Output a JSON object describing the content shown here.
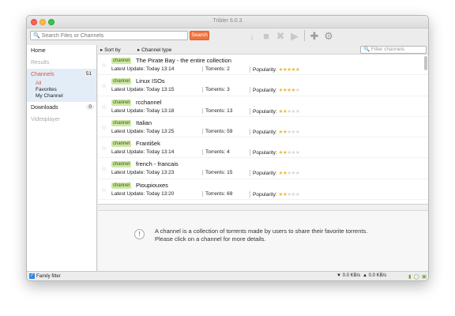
{
  "window": {
    "title": "Tribler 6.0.3"
  },
  "toolbar": {
    "search_placeholder": "Search Files or Channels",
    "search_button": "Search",
    "icons": [
      "download-icon",
      "stop-icon",
      "close-icon",
      "play-icon",
      "add-icon",
      "settings-icon"
    ]
  },
  "sidebar": {
    "home": "Home",
    "results": "Results",
    "channels": "Channels",
    "channels_count": "51",
    "sub_all": "All",
    "sub_favorites": "Favorites",
    "sub_my_channel": "My Channel",
    "downloads": "Downloads",
    "downloads_count": "0",
    "videoplayer": "Videoplayer"
  },
  "list_header": {
    "sort_by": "Sort by",
    "channel_type": "Channel type",
    "filter_placeholder": "Filter channels"
  },
  "channel_badge": "channel",
  "channels": [
    {
      "name": "The Pirate Bay - the entire collection",
      "update": "Latest Update: Today 13:14",
      "torrents": "Torrents: 2",
      "popularity_label": "Popularity:",
      "popularity": 5
    },
    {
      "name": "Linux ISOs",
      "update": "Latest Update: Today 13:15",
      "torrents": "Torrents: 3",
      "popularity_label": "Popularity:",
      "popularity": 3.5
    },
    {
      "name": "rcchannel",
      "update": "Latest Update: Today 13:18",
      "torrents": "Torrents: 13",
      "popularity_label": "Popularity:",
      "popularity": 2
    },
    {
      "name": "Italian",
      "update": "Latest Update: Today 13:25",
      "torrents": "Torrents: 59",
      "popularity_label": "Popularity:",
      "popularity": 2
    },
    {
      "name": "František",
      "update": "Latest Update: Today 13:14",
      "torrents": "Torrents: 4",
      "popularity_label": "Popularity:",
      "popularity": 2
    },
    {
      "name": "french - francais",
      "update": "Latest Update: Today 13:23",
      "torrents": "Torrents: 15",
      "popularity_label": "Popularity:",
      "popularity": 2
    },
    {
      "name": "Pioupiouxes",
      "update": "Latest Update: Today 13:20",
      "torrents": "Torrents: 69",
      "popularity_label": "Popularity:",
      "popularity": 2
    }
  ],
  "info": {
    "line1": "A channel is a collection of torrents made by users to share their favorite torrents.",
    "line2": "Please click on a channel for more details."
  },
  "statusbar": {
    "family_filter": "Family filter",
    "down_speed": "▼ 0.0 KB/s",
    "up_speed": "▲ 0.0 KB/s"
  }
}
